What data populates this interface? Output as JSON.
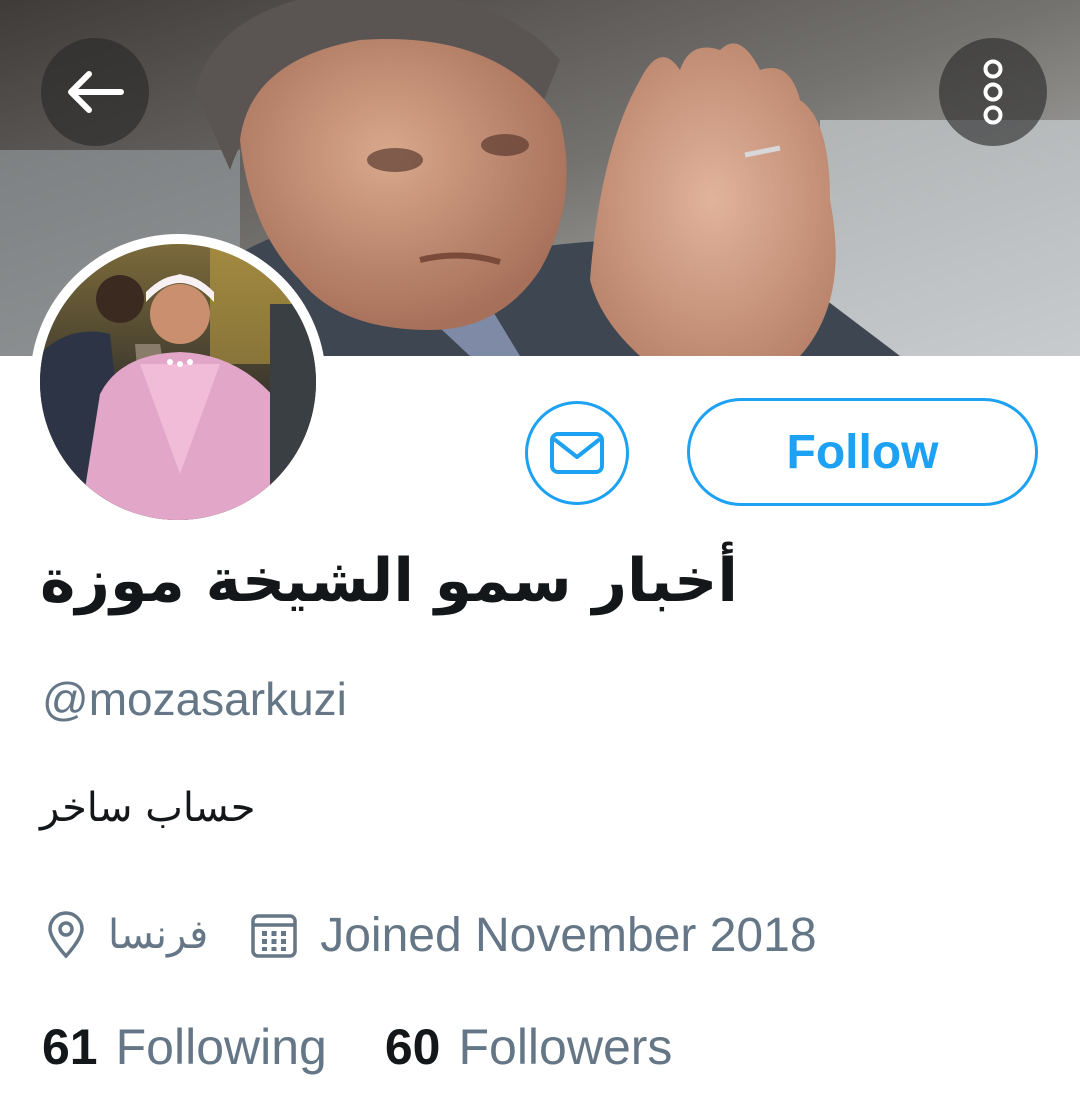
{
  "profile": {
    "display_name": "أخبار سمو الشيخة موزة",
    "handle": "@mozasarkuzi",
    "bio": "حساب ساخر",
    "location": "فرنسا",
    "joined": "Joined November 2018"
  },
  "actions": {
    "follow_label": "Follow"
  },
  "stats": {
    "following_count": "61",
    "following_label": "Following",
    "followers_count": "60",
    "followers_label": "Followers"
  },
  "icons": {
    "back": "arrow-left-icon",
    "menu": "more-vertical-icon",
    "message": "envelope-icon",
    "location": "location-pin-icon",
    "calendar": "calendar-icon"
  },
  "colors": {
    "accent": "#1da1f2",
    "secondary_text": "#657786",
    "primary_text": "#14171a"
  }
}
